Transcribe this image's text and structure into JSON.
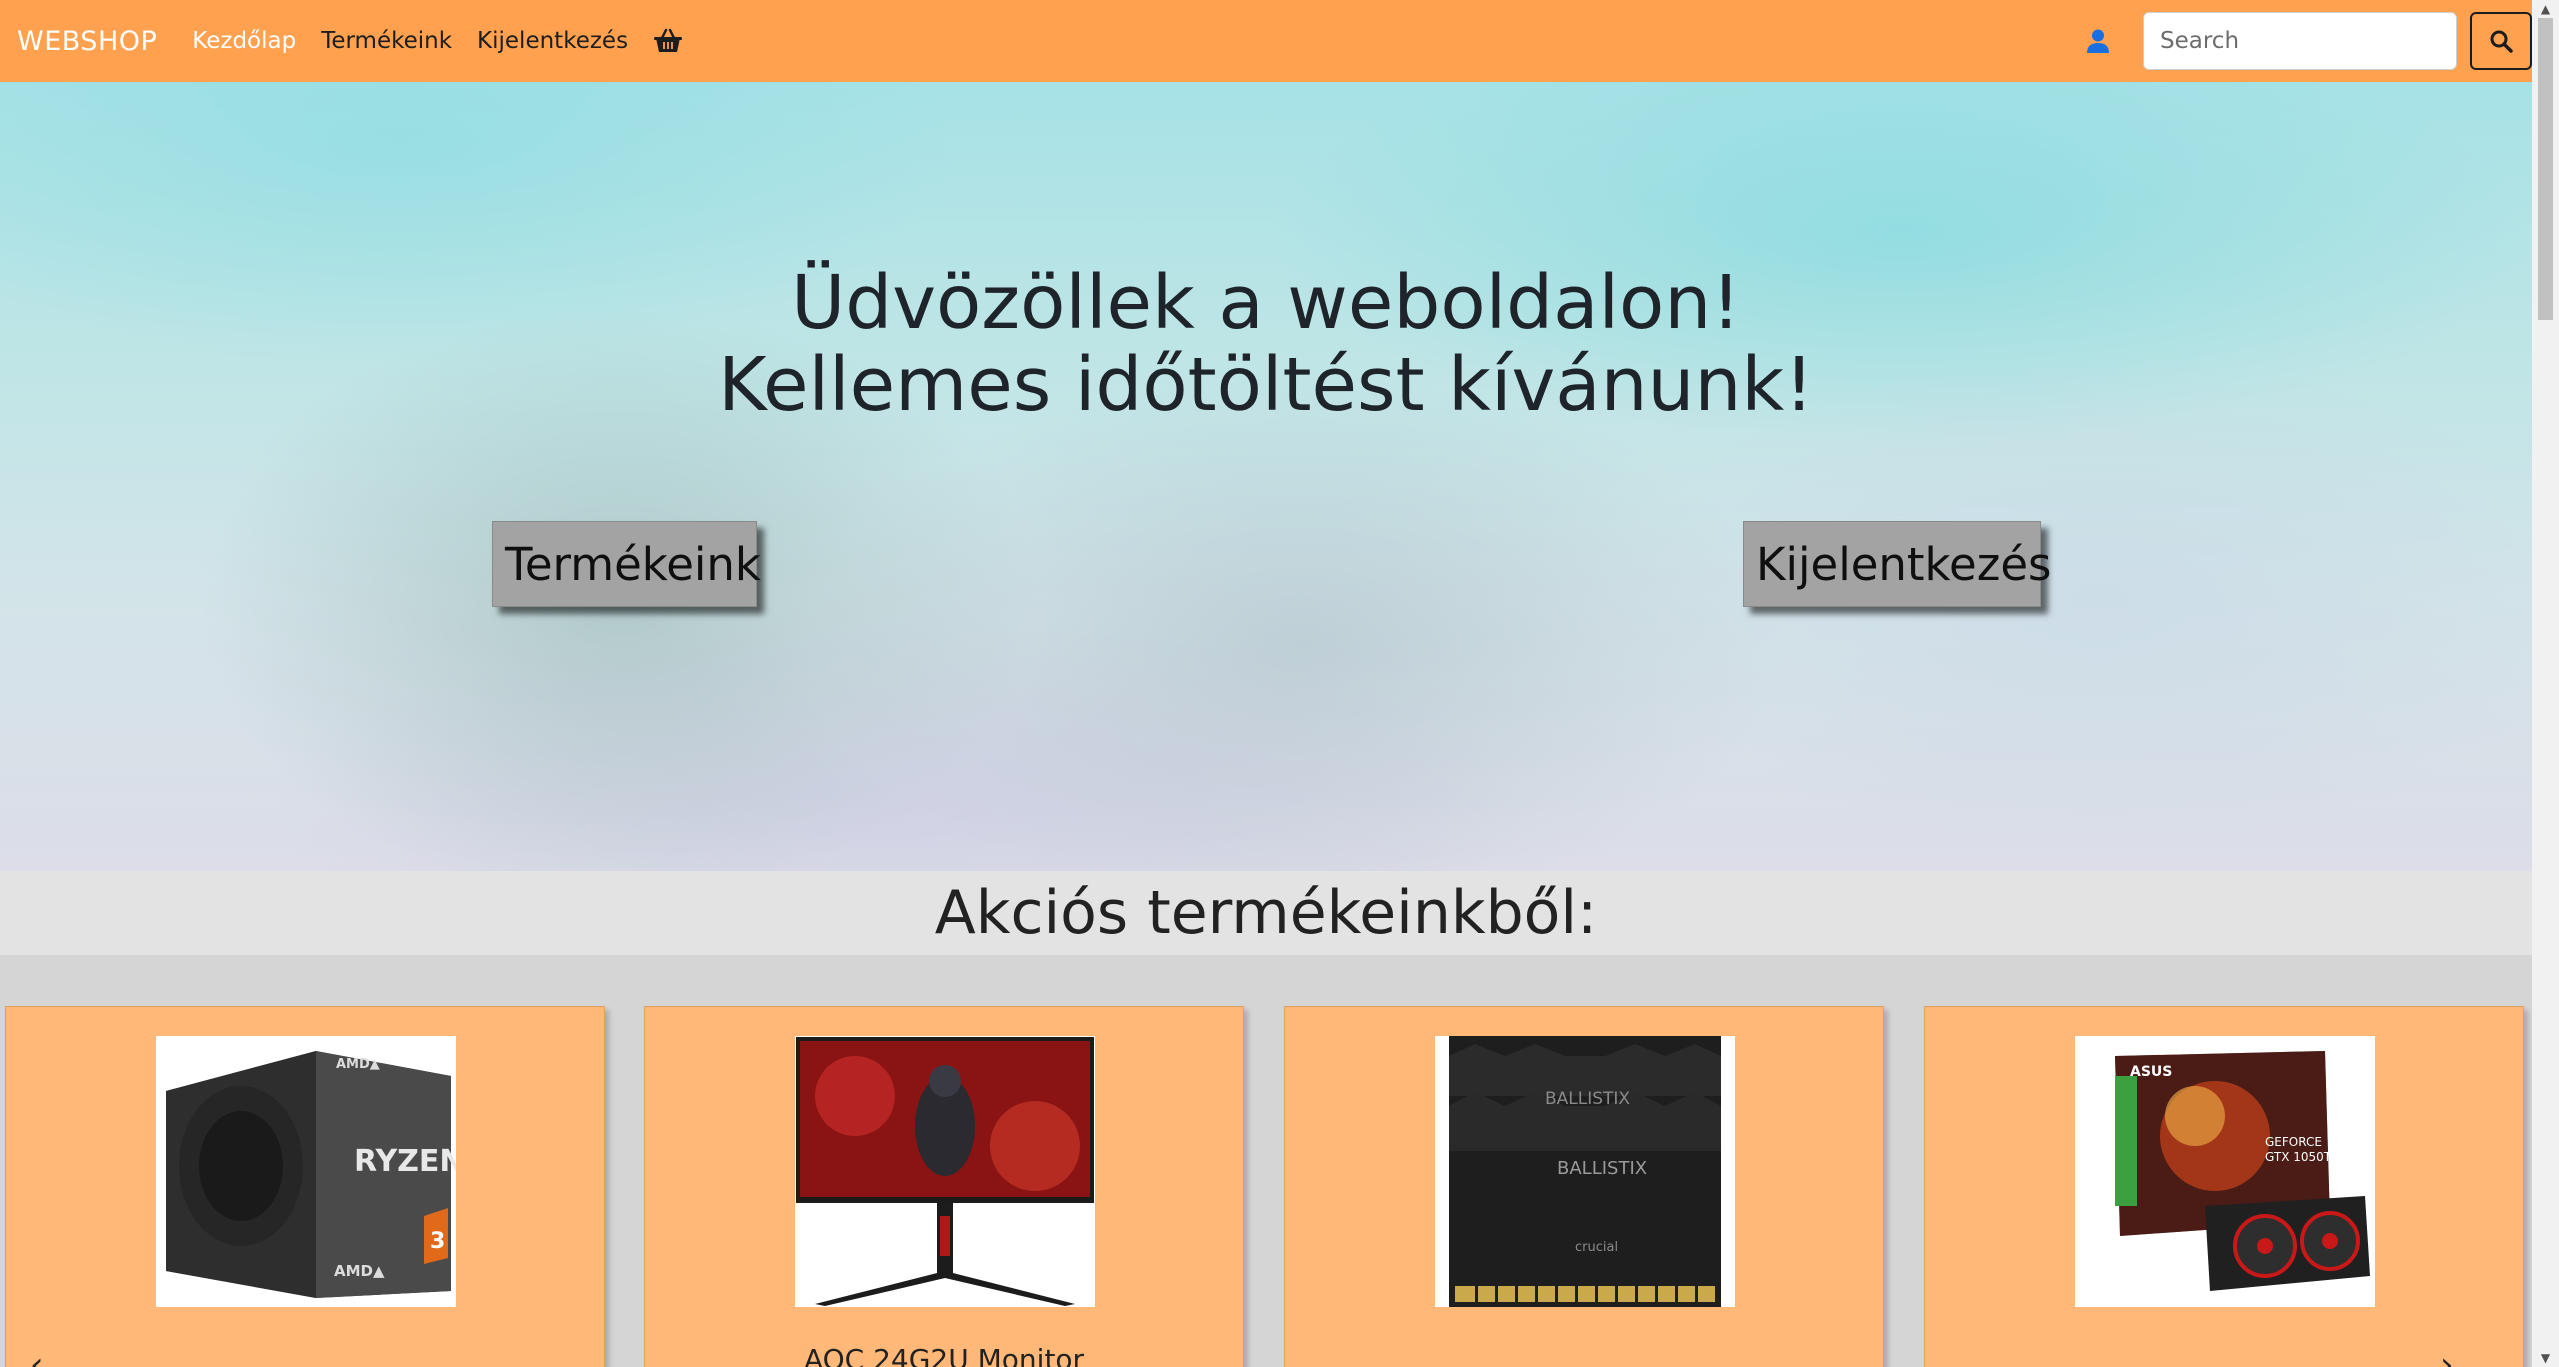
{
  "navbar": {
    "brand": "WEBSHOP",
    "links": [
      "Kezdőlap",
      "Termékeink",
      "Kijelentkezés"
    ],
    "search_placeholder": "Search",
    "color": "#ffa14f"
  },
  "hero": {
    "title_line1": "Üdvözöllek a weboldalon!",
    "title_line2": "Kellemes időtöltést kívánunk!",
    "btn_products": "Termékeink",
    "btn_logout": "Kijelentkezés"
  },
  "section": {
    "title": "Akciós termékeinkből:"
  },
  "cards": [
    {
      "name": "",
      "icon": "amd-ryzen-3-box-image"
    },
    {
      "name": "AOC 24G2U Monitor",
      "icon": "aoc-monitor-image"
    },
    {
      "name": "",
      "icon": "ballistix-ram-image"
    },
    {
      "name": "",
      "icon": "asus-gtx-1050ti-image"
    }
  ],
  "carousel": {
    "prev": "‹",
    "next": "›"
  }
}
